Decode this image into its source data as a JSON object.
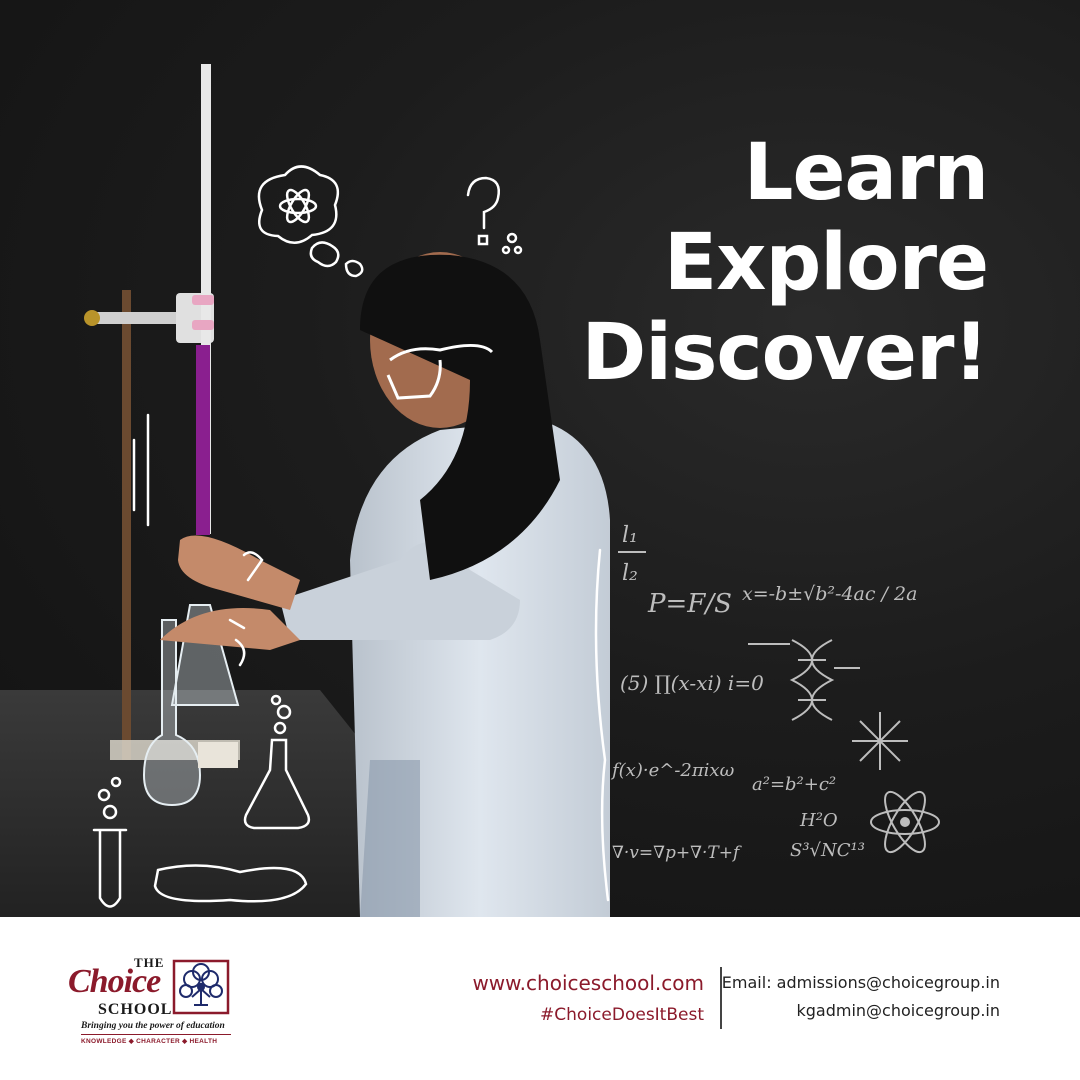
{
  "headline": {
    "line1": "Learn",
    "line2": "Explore",
    "line3": "Discover!"
  },
  "chalkboard_equations": {
    "ratio_top": "l₁",
    "ratio_bottom": "l₂",
    "pressure": "P=F/S",
    "quadratic": "x=-b±√b²-4ac / 2a",
    "product": "(5) ∏(x-xi) i=0",
    "fourier": "f(x)·e^-2πixω",
    "pythagoras": "a²=b²+c²",
    "water": "H²O",
    "cube_root": "S³√NC¹³",
    "divergence": "∇·v=∇p+∇·T+f"
  },
  "logo": {
    "the": "THE",
    "choice": "Choice",
    "school": "SCHOOL",
    "tagline": "Bringing you the power of education",
    "values": "KNOWLEDGE ◆ CHARACTER ◆ HEALTH"
  },
  "contact": {
    "website": "www.choiceschool.com",
    "hashtag": "#ChoiceDoesItBest",
    "email_line1": "Email: admissions@choicegroup.in",
    "email_line2": "kgadmin@choicegroup.in"
  },
  "colors": {
    "brand": "#8b1a2b",
    "board": "#1c1c1c",
    "text_light": "#ffffff"
  }
}
